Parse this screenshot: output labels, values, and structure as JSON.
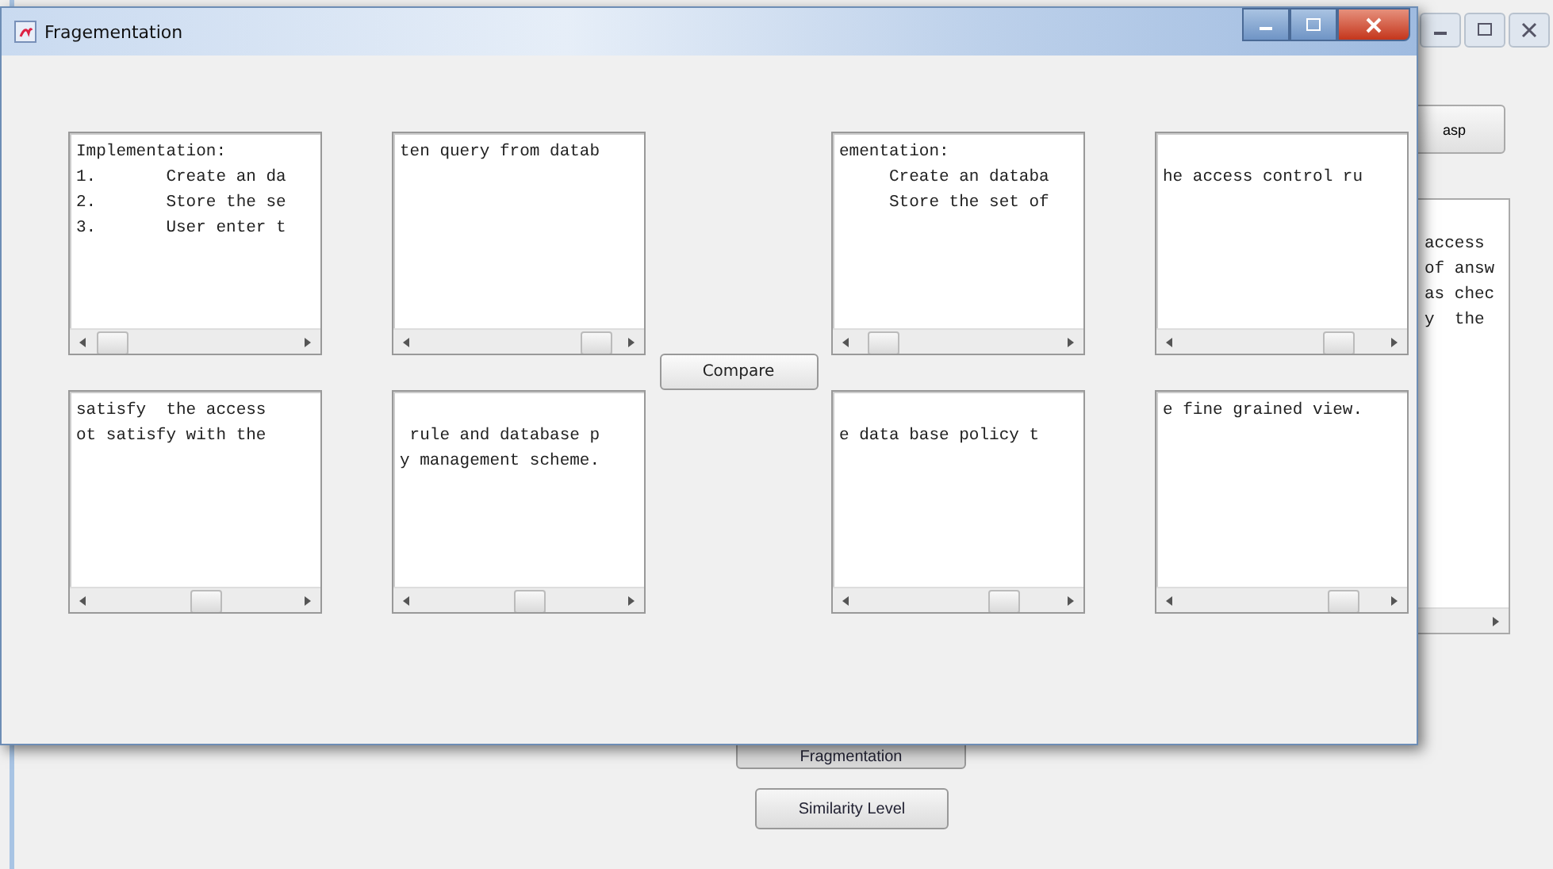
{
  "back_window": {
    "top_button": "asp",
    "text_area": {
      "starts_blank": true,
      "lines": [
        "access",
        "of answ",
        "as chec",
        "y  the"
      ]
    },
    "buttons": [
      "Fragmentation",
      "Similarity Level"
    ]
  },
  "window": {
    "title": "Fragementation"
  },
  "text_areas": [
    {
      "starts_blank": false,
      "lines": [
        "Implementation:",
        "1.       Create an da",
        "2.       Store the se",
        "3.       User enter t"
      ]
    },
    {
      "starts_blank": false,
      "lines": [
        "ten query from datab"
      ]
    },
    {
      "starts_blank": false,
      "lines": [
        "satisfy  the access",
        "ot satisfy with the"
      ]
    },
    {
      "starts_blank": true,
      "lines": [
        " rule and database p",
        "y management scheme."
      ]
    },
    {
      "starts_blank": false,
      "lines": [
        "ementation:",
        "     Create an databa",
        "     Store the set of"
      ]
    },
    {
      "starts_blank": true,
      "lines": [
        "he access control ru"
      ]
    },
    {
      "starts_blank": true,
      "lines": [
        "e data base policy t"
      ]
    },
    {
      "starts_blank": false,
      "lines": [
        "e fine grained view."
      ]
    }
  ],
  "compare_button": "Compare"
}
